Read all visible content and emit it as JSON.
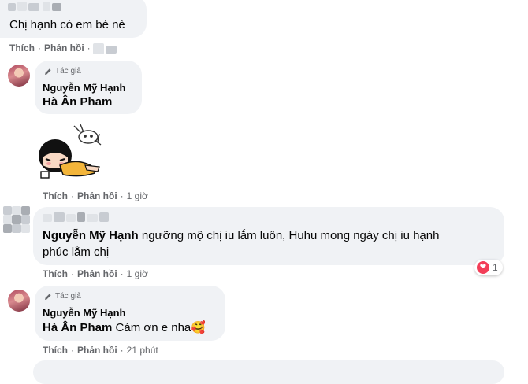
{
  "comments": [
    {
      "text": "Chị hạnh có em bé nè",
      "actions": {
        "like": "Thích",
        "reply": "Phản hồi"
      }
    },
    {
      "author_badge": "Tác giả",
      "author": "Nguyễn Mỹ Hạnh",
      "mention": "Hà Ân Pham",
      "sticker": "crying-girl-sticker",
      "actions": {
        "like": "Thích",
        "reply": "Phản hồi",
        "time": "1 giờ"
      }
    },
    {
      "mention": "Nguyễn Mỹ Hạnh",
      "text_line1": "ngưỡng mộ chị iu lắm luôn, Huhu mong ngày chị iu hạnh",
      "text_line2": "phúc lắm chị",
      "reaction": {
        "icon": "heart-icon",
        "count": "1",
        "color": "#f33e58"
      },
      "actions": {
        "like": "Thích",
        "reply": "Phản hồi",
        "time": "1 giờ"
      }
    },
    {
      "author_badge": "Tác giả",
      "author": "Nguyễn Mỹ Hạnh",
      "mention": "Hà Ân Pham",
      "text": "Cám ơn e nha🥰",
      "actions": {
        "like": "Thích",
        "reply": "Phản hồi",
        "time": "21 phút"
      }
    }
  ],
  "colors": {
    "bubble": "#f0f2f5",
    "meta": "#65676b",
    "text": "#050505"
  }
}
